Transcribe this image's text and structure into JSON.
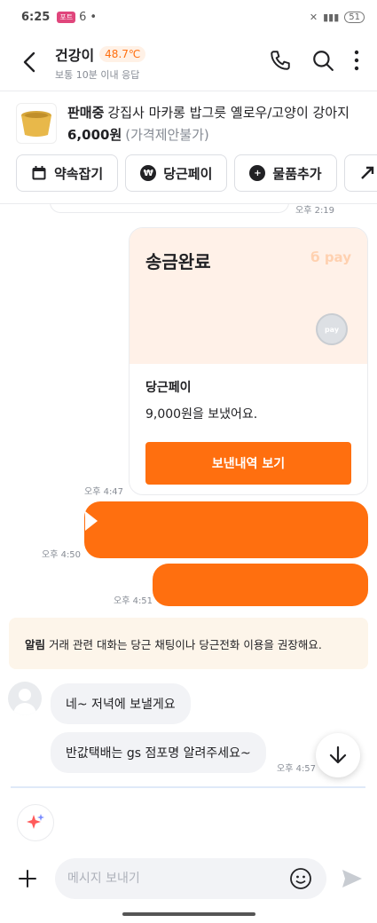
{
  "status_bar": {
    "time": "6:25",
    "app_badge": "포트",
    "extra": "6",
    "battery": "51"
  },
  "header": {
    "username": "건강이",
    "temperature": "48.7℃",
    "subtitle": "보통 10분 이내 응답"
  },
  "product": {
    "status": "판매중",
    "title": "강집사 마카롱 밥그릇 옐로우/고양이 강아지",
    "price": "6,000원",
    "negotiation": "(가격제안불가)"
  },
  "actions": [
    {
      "label": "약속잡기"
    },
    {
      "label": "당근페이"
    },
    {
      "label": "물품추가"
    }
  ],
  "chat": {
    "messages": [
      {
        "time": "오후 2:19"
      },
      {
        "type": "pay_card",
        "title": "송금완료",
        "logo": "pay",
        "service": "당근페이",
        "description": "9,000원을 보냈어요.",
        "button": "보낸내역 보기",
        "time": "오후 4:47"
      },
      {
        "type": "redacted",
        "time": "오후 4:50"
      },
      {
        "type": "redacted",
        "time": "오후 4:51"
      },
      {
        "type": "notice",
        "tag": "알림",
        "text": "거래 관련 대화는 당근 채팅이나 당근전화 이용을 권장해요."
      },
      {
        "type": "incoming",
        "text": "네~ 저녁에 보낼게요"
      },
      {
        "type": "incoming",
        "text": "반값택배는 gs 점포명 알려주세요~",
        "time": "오후 4:57"
      }
    ]
  },
  "composer": {
    "placeholder": "메시지 보내기"
  },
  "colors": {
    "accent": "#ff6f0f",
    "pay_card_bg": "#fff1e8",
    "notice_bg": "#fdf5ea",
    "bubble_in": "#f2f3f6"
  },
  "icons": [
    "back-icon",
    "phone-icon",
    "search-icon",
    "more-icon",
    "calendar-icon",
    "won-icon",
    "plus-circle-icon",
    "coin-icon",
    "chevron-down-icon",
    "sparkle-icon",
    "plus-icon",
    "emoji-icon",
    "send-icon"
  ]
}
